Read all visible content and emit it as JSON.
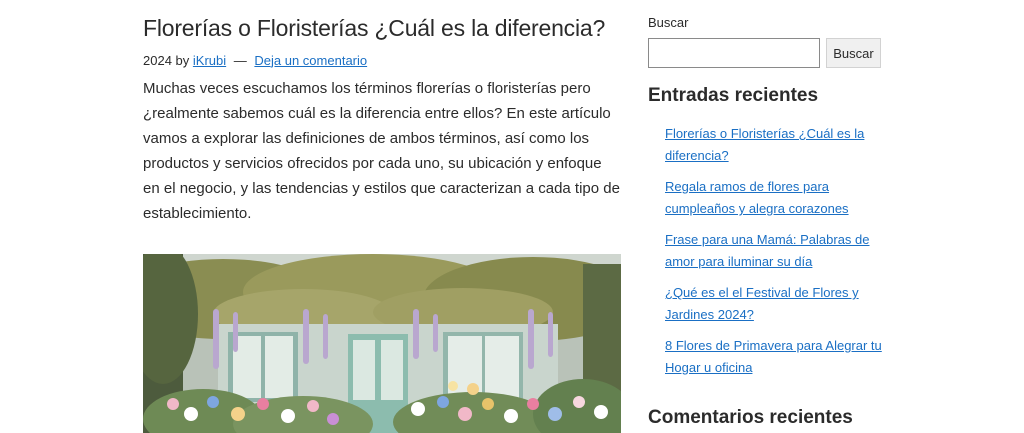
{
  "article": {
    "title": "Florerías o Floristerías ¿Cuál es la diferencia?",
    "meta_year": "2024 by",
    "author": "iKrubi",
    "meta_sep": "—",
    "comment_link": "Deja un comentario",
    "excerpt": "Muchas veces escuchamos los términos florerías o floristerías pero ¿realmente sabemos cuál es la diferencia entre ellos? En este artículo vamos a explorar las definiciones de ambos términos, así como los productos y servicios ofrecidos por cada uno, su ubicación y enfoque en el negocio, y las tendencias y estilos que caracterizan a cada tipo de establecimiento."
  },
  "sidebar": {
    "search_label": "Buscar",
    "search_value": "",
    "search_button": "Buscar",
    "recent_title": "Entradas recientes",
    "recent_posts": [
      "Florerías o Floristerías ¿Cuál es la diferencia?",
      "Regala ramos de flores para cumpleaños y alegra corazones",
      "Frase para una Mamá: Palabras de amor para iluminar su día",
      "¿Qué es el el Festival de Flores y Jardines 2024?",
      "8 Flores de Primavera para Alegrar tu Hogar u oficina"
    ],
    "comments_title": "Comentarios recientes"
  },
  "colors": {
    "link": "#1a6fc4",
    "text": "#2b2b2b"
  }
}
